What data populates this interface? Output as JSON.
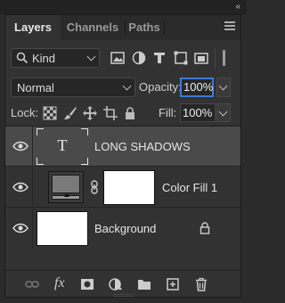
{
  "window": {
    "collapse_glyph": "«"
  },
  "tabs": [
    {
      "label": "Layers",
      "active": true
    },
    {
      "label": "Channels",
      "active": false
    },
    {
      "label": "Paths",
      "active": false
    }
  ],
  "panel_menu_icon": "hamburger-icon",
  "filter": {
    "kind_label": "Kind",
    "icons": [
      "image-filter-icon",
      "adjustment-filter-icon",
      "type-filter-icon",
      "shape-filter-icon",
      "smart-object-filter-icon"
    ]
  },
  "blend_mode": {
    "value": "Normal"
  },
  "opacity": {
    "label": "Opacity:",
    "value": "100%"
  },
  "lock": {
    "label": "Lock:",
    "icons": [
      "lock-transparent-pixels-icon",
      "lock-image-pixels-icon",
      "lock-position-icon",
      "lock-artboard-icon",
      "lock-all-icon"
    ]
  },
  "fill": {
    "label": "Fill:",
    "value": "100%"
  },
  "layers": [
    {
      "name": "LONG SHADOWS",
      "type": "text",
      "selected": true,
      "visible": true,
      "thumb_glyph": "T"
    },
    {
      "name": "Color Fill 1",
      "type": "fill",
      "selected": false,
      "visible": true
    },
    {
      "name": "Background",
      "type": "background",
      "selected": false,
      "visible": true,
      "locked": true
    }
  ],
  "bottom_icons": [
    "link-layers-icon",
    "fx-icon",
    "add-mask-icon",
    "adjustment-layer-icon",
    "new-group-icon",
    "new-layer-icon",
    "delete-layer-icon"
  ],
  "fx_label": "fx",
  "colors": {
    "accent": "#3c7bd6",
    "panel": "#323232",
    "selected_row": "#4a4a4a"
  }
}
